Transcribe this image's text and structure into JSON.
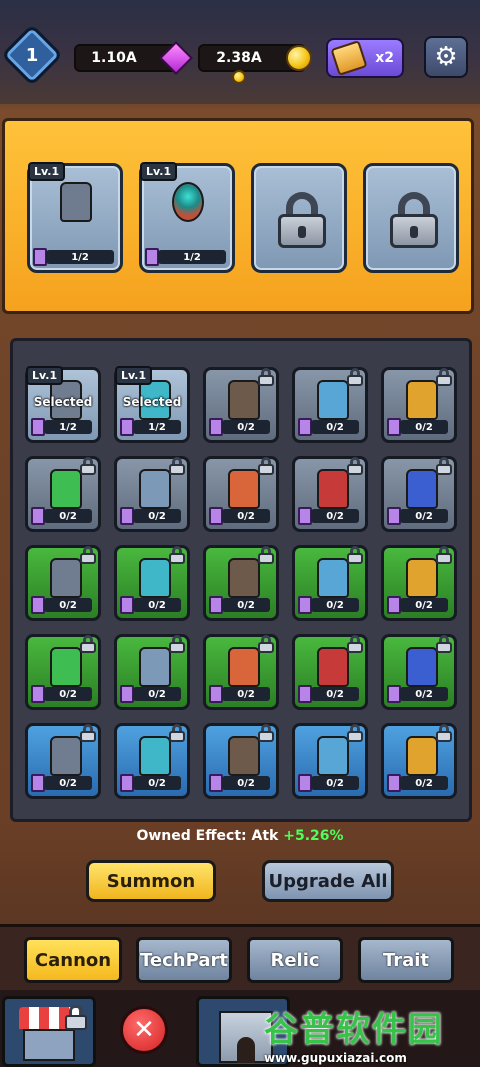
{
  "header": {
    "level": "1",
    "gems": "1.10A",
    "coins": "2.38A",
    "boost_multiplier": "x2"
  },
  "equipped": [
    {
      "level": "Lv.1",
      "count": "1/2",
      "locked": false,
      "icon": "cannon-barrel-icon"
    },
    {
      "level": "Lv.1",
      "count": "1/2",
      "locked": false,
      "icon": "orb-tower-icon"
    },
    {
      "level": "",
      "count": "",
      "locked": true,
      "icon": "padlock-icon"
    },
    {
      "level": "",
      "count": "",
      "locked": true,
      "icon": "padlock-icon"
    }
  ],
  "selected_label": "Selected",
  "grid": [
    {
      "count": "1/2",
      "level": "Lv.1",
      "selected": true,
      "rarity": "grey",
      "icon": "cannon-barrel-icon"
    },
    {
      "count": "1/2",
      "level": "Lv.1",
      "selected": true,
      "rarity": "grey",
      "icon": "orb-tower-icon"
    },
    {
      "count": "0/2",
      "rarity": "grey",
      "icon": "bunker-icon"
    },
    {
      "count": "0/2",
      "rarity": "grey",
      "icon": "laser-tower-icon"
    },
    {
      "count": "0/2",
      "rarity": "grey",
      "icon": "horned-tower-icon"
    },
    {
      "count": "0/2",
      "rarity": "grey",
      "icon": "tank-icon"
    },
    {
      "count": "0/2",
      "rarity": "grey",
      "icon": "frost-tower-icon"
    },
    {
      "count": "0/2",
      "rarity": "grey",
      "icon": "lantern-tower-icon"
    },
    {
      "count": "0/2",
      "rarity": "grey",
      "icon": "red-turret-icon"
    },
    {
      "count": "0/2",
      "rarity": "grey",
      "icon": "blue-turret-icon"
    },
    {
      "count": "0/2",
      "rarity": "green",
      "icon": "cannon-barrel-icon"
    },
    {
      "count": "0/2",
      "rarity": "green",
      "icon": "orb-tower-icon"
    },
    {
      "count": "0/2",
      "rarity": "green",
      "icon": "bunker-icon"
    },
    {
      "count": "0/2",
      "rarity": "green",
      "icon": "laser-tower-icon"
    },
    {
      "count": "0/2",
      "rarity": "green",
      "icon": "horned-tower-icon"
    },
    {
      "count": "0/2",
      "rarity": "green",
      "icon": "tank-icon"
    },
    {
      "count": "0/2",
      "rarity": "green",
      "icon": "frost-tower-icon"
    },
    {
      "count": "0/2",
      "rarity": "green",
      "icon": "lantern-tower-icon"
    },
    {
      "count": "0/2",
      "rarity": "green",
      "icon": "red-turret-icon"
    },
    {
      "count": "0/2",
      "rarity": "green",
      "icon": "blue-turret-icon"
    },
    {
      "count": "0/2",
      "rarity": "blue",
      "icon": "cannon-barrel-icon"
    },
    {
      "count": "0/2",
      "rarity": "blue",
      "icon": "orb-tower-icon"
    },
    {
      "count": "0/2",
      "rarity": "blue",
      "icon": "bunker-icon"
    },
    {
      "count": "0/2",
      "rarity": "blue",
      "icon": "laser-tower-icon"
    },
    {
      "count": "0/2",
      "rarity": "blue",
      "icon": "horned-tower-icon"
    }
  ],
  "effect": {
    "label": "Owned Effect: Atk",
    "value": "+5.26%"
  },
  "actions": {
    "summon": "Summon",
    "upgrade_all": "Upgrade All"
  },
  "tabs": [
    {
      "label": "Cannon",
      "active": true
    },
    {
      "label": "TechPart",
      "active": false
    },
    {
      "label": "Relic",
      "active": false
    },
    {
      "label": "Trait",
      "active": false
    }
  ],
  "watermark": {
    "cn": "谷普软件园",
    "url": "www.gupuxiazai.com"
  },
  "colors": {
    "gold": "#f5b81e",
    "effect_green": "#4cff5a",
    "rarity_grey": "#7f98b3",
    "rarity_green": "#3a9b30",
    "rarity_blue": "#3a86c8"
  }
}
